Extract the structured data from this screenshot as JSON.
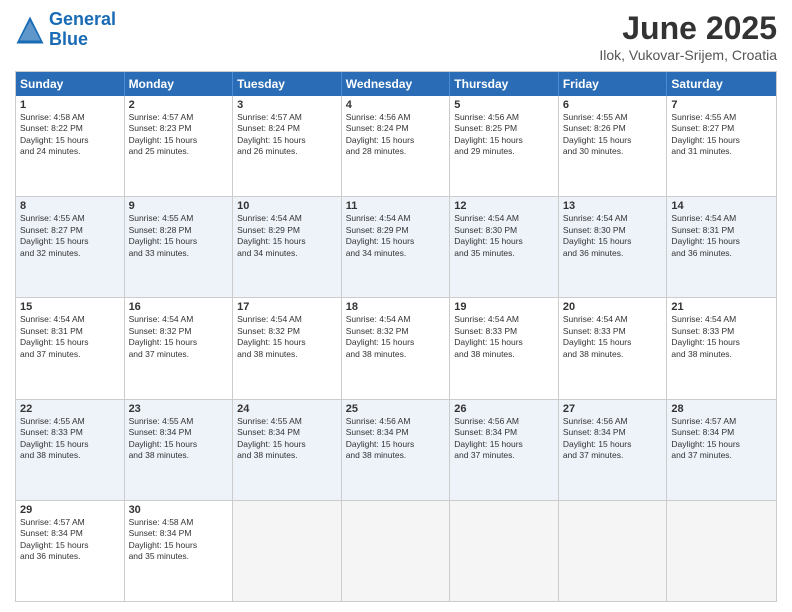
{
  "logo": {
    "line1": "General",
    "line2": "Blue"
  },
  "title": "June 2025",
  "location": "Ilok, Vukovar-Srijem, Croatia",
  "header_days": [
    "Sunday",
    "Monday",
    "Tuesday",
    "Wednesday",
    "Thursday",
    "Friday",
    "Saturday"
  ],
  "rows": [
    {
      "alt": false,
      "cells": [
        {
          "day": "1",
          "text": "Sunrise: 4:58 AM\nSunset: 8:22 PM\nDaylight: 15 hours\nand 24 minutes."
        },
        {
          "day": "2",
          "text": "Sunrise: 4:57 AM\nSunset: 8:23 PM\nDaylight: 15 hours\nand 25 minutes."
        },
        {
          "day": "3",
          "text": "Sunrise: 4:57 AM\nSunset: 8:24 PM\nDaylight: 15 hours\nand 26 minutes."
        },
        {
          "day": "4",
          "text": "Sunrise: 4:56 AM\nSunset: 8:24 PM\nDaylight: 15 hours\nand 28 minutes."
        },
        {
          "day": "5",
          "text": "Sunrise: 4:56 AM\nSunset: 8:25 PM\nDaylight: 15 hours\nand 29 minutes."
        },
        {
          "day": "6",
          "text": "Sunrise: 4:55 AM\nSunset: 8:26 PM\nDaylight: 15 hours\nand 30 minutes."
        },
        {
          "day": "7",
          "text": "Sunrise: 4:55 AM\nSunset: 8:27 PM\nDaylight: 15 hours\nand 31 minutes."
        }
      ]
    },
    {
      "alt": true,
      "cells": [
        {
          "day": "8",
          "text": "Sunrise: 4:55 AM\nSunset: 8:27 PM\nDaylight: 15 hours\nand 32 minutes."
        },
        {
          "day": "9",
          "text": "Sunrise: 4:55 AM\nSunset: 8:28 PM\nDaylight: 15 hours\nand 33 minutes."
        },
        {
          "day": "10",
          "text": "Sunrise: 4:54 AM\nSunset: 8:29 PM\nDaylight: 15 hours\nand 34 minutes."
        },
        {
          "day": "11",
          "text": "Sunrise: 4:54 AM\nSunset: 8:29 PM\nDaylight: 15 hours\nand 34 minutes."
        },
        {
          "day": "12",
          "text": "Sunrise: 4:54 AM\nSunset: 8:30 PM\nDaylight: 15 hours\nand 35 minutes."
        },
        {
          "day": "13",
          "text": "Sunrise: 4:54 AM\nSunset: 8:30 PM\nDaylight: 15 hours\nand 36 minutes."
        },
        {
          "day": "14",
          "text": "Sunrise: 4:54 AM\nSunset: 8:31 PM\nDaylight: 15 hours\nand 36 minutes."
        }
      ]
    },
    {
      "alt": false,
      "cells": [
        {
          "day": "15",
          "text": "Sunrise: 4:54 AM\nSunset: 8:31 PM\nDaylight: 15 hours\nand 37 minutes."
        },
        {
          "day": "16",
          "text": "Sunrise: 4:54 AM\nSunset: 8:32 PM\nDaylight: 15 hours\nand 37 minutes."
        },
        {
          "day": "17",
          "text": "Sunrise: 4:54 AM\nSunset: 8:32 PM\nDaylight: 15 hours\nand 38 minutes."
        },
        {
          "day": "18",
          "text": "Sunrise: 4:54 AM\nSunset: 8:32 PM\nDaylight: 15 hours\nand 38 minutes."
        },
        {
          "day": "19",
          "text": "Sunrise: 4:54 AM\nSunset: 8:33 PM\nDaylight: 15 hours\nand 38 minutes."
        },
        {
          "day": "20",
          "text": "Sunrise: 4:54 AM\nSunset: 8:33 PM\nDaylight: 15 hours\nand 38 minutes."
        },
        {
          "day": "21",
          "text": "Sunrise: 4:54 AM\nSunset: 8:33 PM\nDaylight: 15 hours\nand 38 minutes."
        }
      ]
    },
    {
      "alt": true,
      "cells": [
        {
          "day": "22",
          "text": "Sunrise: 4:55 AM\nSunset: 8:33 PM\nDaylight: 15 hours\nand 38 minutes."
        },
        {
          "day": "23",
          "text": "Sunrise: 4:55 AM\nSunset: 8:34 PM\nDaylight: 15 hours\nand 38 minutes."
        },
        {
          "day": "24",
          "text": "Sunrise: 4:55 AM\nSunset: 8:34 PM\nDaylight: 15 hours\nand 38 minutes."
        },
        {
          "day": "25",
          "text": "Sunrise: 4:56 AM\nSunset: 8:34 PM\nDaylight: 15 hours\nand 38 minutes."
        },
        {
          "day": "26",
          "text": "Sunrise: 4:56 AM\nSunset: 8:34 PM\nDaylight: 15 hours\nand 37 minutes."
        },
        {
          "day": "27",
          "text": "Sunrise: 4:56 AM\nSunset: 8:34 PM\nDaylight: 15 hours\nand 37 minutes."
        },
        {
          "day": "28",
          "text": "Sunrise: 4:57 AM\nSunset: 8:34 PM\nDaylight: 15 hours\nand 37 minutes."
        }
      ]
    },
    {
      "alt": false,
      "cells": [
        {
          "day": "29",
          "text": "Sunrise: 4:57 AM\nSunset: 8:34 PM\nDaylight: 15 hours\nand 36 minutes."
        },
        {
          "day": "30",
          "text": "Sunrise: 4:58 AM\nSunset: 8:34 PM\nDaylight: 15 hours\nand 35 minutes."
        },
        {
          "day": "",
          "text": ""
        },
        {
          "day": "",
          "text": ""
        },
        {
          "day": "",
          "text": ""
        },
        {
          "day": "",
          "text": ""
        },
        {
          "day": "",
          "text": ""
        }
      ]
    }
  ]
}
